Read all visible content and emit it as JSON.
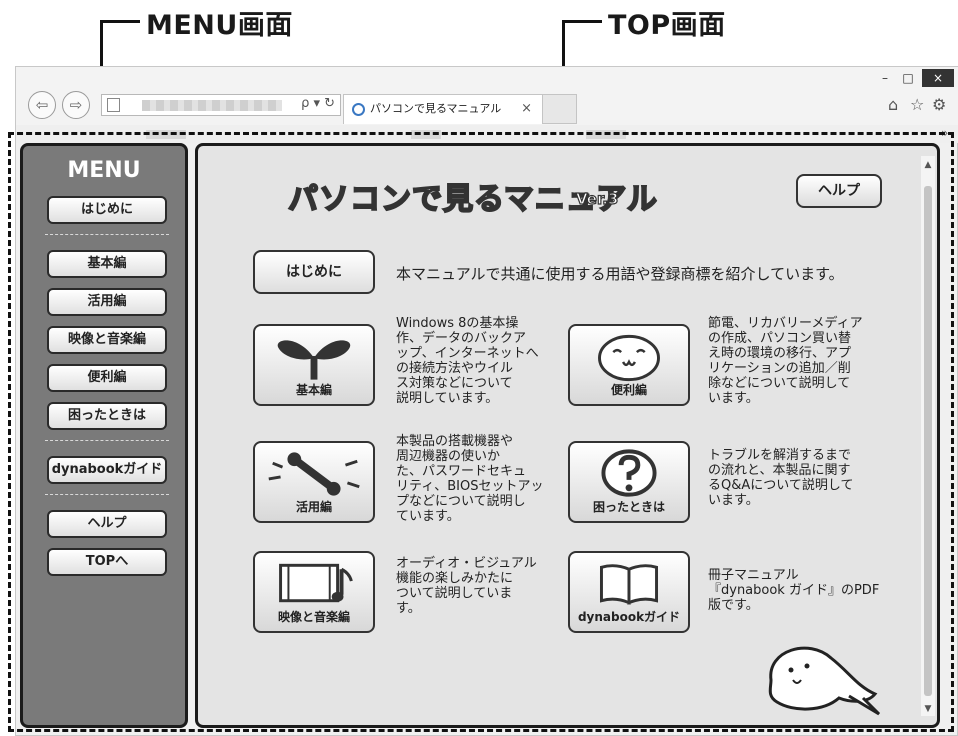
{
  "callouts": {
    "menu": "MENU画面",
    "top": "TOP画面"
  },
  "browser": {
    "tab_title": "パソコンで見るマニュアル",
    "addr_tools": "ρ ▾ ↻",
    "tab_close": "×",
    "window_controls": {
      "minimize": "–",
      "maximize": "□",
      "close": "×"
    },
    "nav": {
      "back": "⇦",
      "forward": "⇨"
    },
    "toolbar_icons": {
      "home": "⌂",
      "favorites": "☆",
      "settings": "⚙"
    },
    "chevron": "»"
  },
  "menu": {
    "title": "MENU",
    "items": [
      "はじめに",
      "基本編",
      "活用編",
      "映像と音楽編",
      "便利編",
      "困ったときは",
      "dynabookガイド",
      "ヘルプ",
      "TOPへ"
    ]
  },
  "top": {
    "title": "パソコンで見るマニュアル",
    "version": "Ver.3",
    "help": "ヘルプ",
    "intro": {
      "label": "はじめに",
      "desc": "本マニュアルで共通に使用する用語や登録商標を紹介しています。"
    },
    "features": [
      {
        "label": "基本編",
        "icon": "sprout-icon",
        "desc": "Windows 8の基本操\n作、データのバックア\nップ、インターネットへ\nの接続方法やウイル\nス対策などについて\n説明しています。"
      },
      {
        "label": "便利編",
        "icon": "face-icon",
        "desc": "節電、リカバリーメディア\nの作成、パソコン買い替\nえ時の環境の移行、アプ\nリケーションの追加／削\n除などについて説明して\nいます。"
      },
      {
        "label": "活用編",
        "icon": "wrench-icon",
        "desc": "本製品の搭載機器や\n周辺機器の使いか\nた、パスワードセキュ\nリティ、BIOSセットアッ\nプなどについて説明し\nています。"
      },
      {
        "label": "困ったときは",
        "icon": "question-icon",
        "desc": "トラブルを解消するまで\nの流れと、本製品に関す\nるQ&Aについて説明して\nいます。"
      },
      {
        "label": "映像と音楽編",
        "icon": "film-music-icon",
        "desc": "オーディオ・ビジュアル\n機能の楽しみかたに\nついて説明していま\nす。"
      },
      {
        "label": "dynabookガイド",
        "icon": "book-icon",
        "desc": "冊子マニュアル\n『dynabook ガイド』のPDF\n版です。"
      }
    ]
  }
}
